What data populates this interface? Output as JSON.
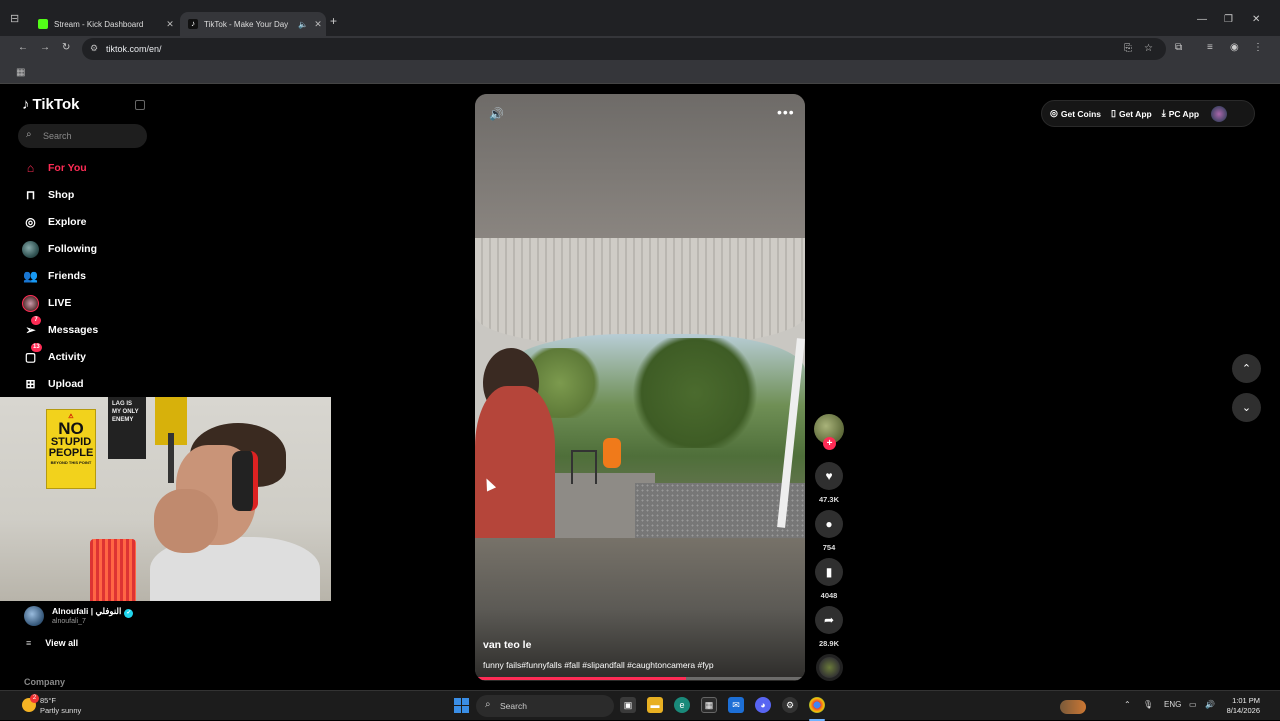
{
  "browser": {
    "tabs": [
      {
        "title": "Stream - Kick Dashboard",
        "favicon_color": "#53fc18"
      },
      {
        "title": "TikTok - Make Your Day",
        "favicon_color": "#000000"
      }
    ],
    "url": "tiktok.com/en/"
  },
  "sidebar": {
    "logo": "TikTok",
    "search_placeholder": "Search",
    "nav": [
      {
        "label": "For You",
        "icon": "home-icon",
        "active": true
      },
      {
        "label": "Shop",
        "icon": "shopping-bag-icon"
      },
      {
        "label": "Explore",
        "icon": "compass-icon"
      },
      {
        "label": "Following",
        "icon": "following-avatar-icon"
      },
      {
        "label": "Friends",
        "icon": "friends-icon"
      },
      {
        "label": "LIVE",
        "icon": "live-avatar-icon"
      },
      {
        "label": "Messages",
        "icon": "messages-icon",
        "badge": "7"
      },
      {
        "label": "Activity",
        "icon": "activity-icon",
        "badge": "13"
      },
      {
        "label": "Upload",
        "icon": "upload-icon"
      }
    ],
    "following_creator": {
      "name": "Alnoufali | النوفلي",
      "handle": "alnoufali_7"
    },
    "view_all": "View all",
    "company": "Company"
  },
  "webcam": {
    "poster_lines": [
      "NO",
      "STUPID",
      "PEOPLE",
      "BEYOND THIS POINT"
    ],
    "poster2": "LAG IS MY ONLY ENEMY"
  },
  "video": {
    "author": "van teo le",
    "caption": "funny fails#funnyfalls #fall #slipandfall #caughtoncamera #fyp",
    "progress": 0.64
  },
  "actions": {
    "likes": "47.3K",
    "comments": "754",
    "saves": "4048",
    "shares": "28.9K"
  },
  "topbar": {
    "coins": "Get Coins",
    "app": "Get App",
    "pc_app": "PC App"
  },
  "taskbar": {
    "temp": "85°F",
    "weather": "Partly sunny",
    "weather_badge": "2",
    "search": "Search",
    "lang": "ENG",
    "time": "1:01 PM",
    "date": "8/14/2026"
  },
  "colors": {
    "accent": "#fe2c55",
    "verified": "#20d5ec"
  }
}
